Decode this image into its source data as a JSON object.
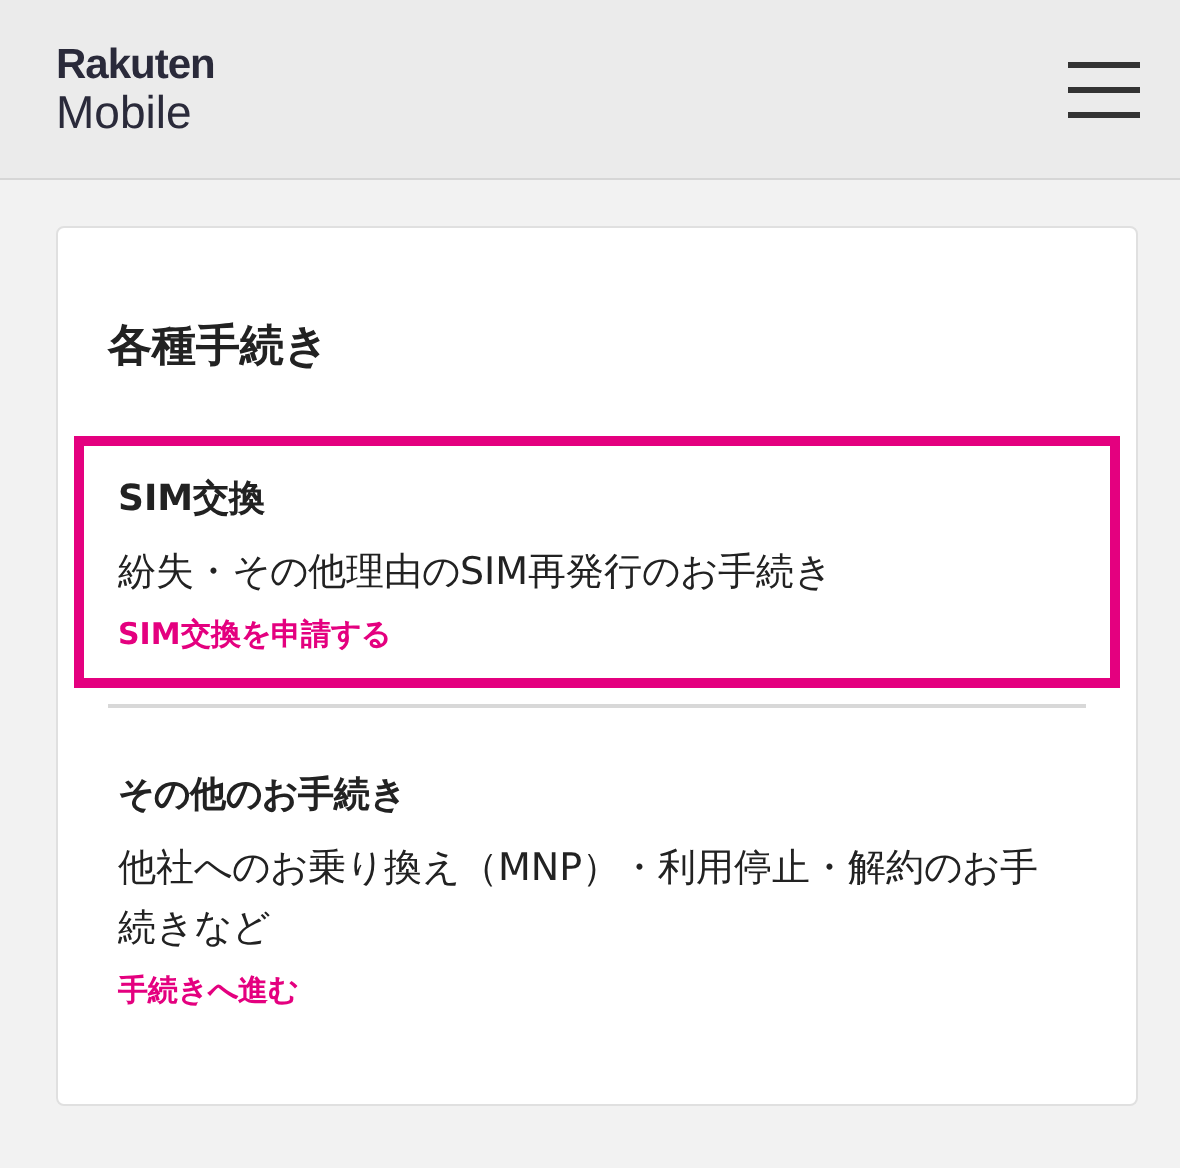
{
  "header": {
    "logo_top": "Rakuten",
    "logo_bottom": "Mobile"
  },
  "card": {
    "title": "各種手続き",
    "sections": [
      {
        "heading": "SIM交換",
        "description": "紛失・その他理由のSIM再発行のお手続き",
        "link": "SIM交換を申請する",
        "highlighted": true
      },
      {
        "heading": "その他のお手続き",
        "description": "他社へのお乗り換え（MNP）・利用停止・解約のお手続きなど",
        "link": "手続きへ進む",
        "highlighted": false
      }
    ]
  }
}
